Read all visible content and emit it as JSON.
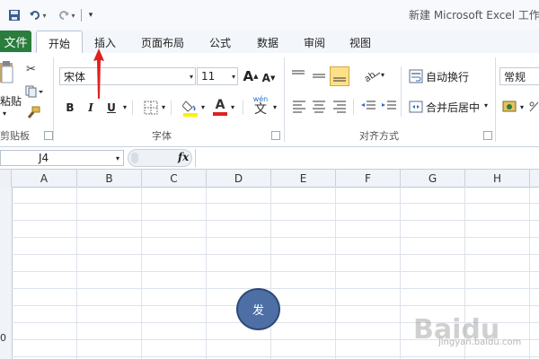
{
  "window_title": "新建 Microsoft Excel 工作",
  "tabs": {
    "file": "文件",
    "home": "开始",
    "insert": "插入",
    "page_layout": "页面布局",
    "formulas": "公式",
    "data": "数据",
    "review": "审阅",
    "view": "视图"
  },
  "ribbon": {
    "clipboard": {
      "paste_label": "粘贴",
      "group_label": "剪贴板"
    },
    "font": {
      "font_name": "宋体",
      "font_size": "11",
      "bold": "B",
      "italic": "I",
      "underline": "U",
      "font_color_letter": "A",
      "phonetic_top": "wén",
      "phonetic_char": "文",
      "grow_letter": "A",
      "shrink_letter": "A",
      "group_label": "字体"
    },
    "alignment": {
      "wrap_text": "自动换行",
      "merge_center": "合并后居中",
      "group_label": "对齐方式"
    },
    "number": {
      "format": "常规"
    }
  },
  "formula_bar": {
    "name_box": "J4",
    "fx_label": "fx"
  },
  "columns": [
    "A",
    "B",
    "C",
    "D",
    "E",
    "F",
    "G",
    "H"
  ],
  "row_partial": "0",
  "shape_text": "发",
  "colors": {
    "file_tab": "#2a7d3d",
    "shape_fill": "#4e6fa6",
    "annotation_arrow": "#e02020"
  },
  "watermark": {
    "brand": "Baidu",
    "sub": "jingyan.baidu.com"
  }
}
